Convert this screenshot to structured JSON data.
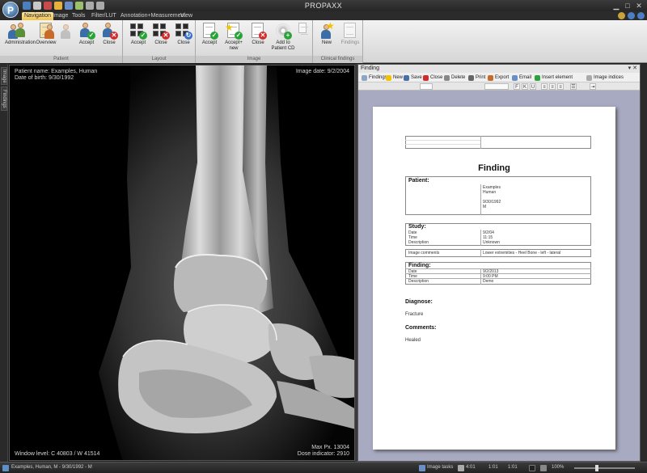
{
  "app": {
    "title": "PROPAXX",
    "logo_letter": "P"
  },
  "tabs": [
    {
      "label": "Navigation",
      "active": true
    },
    {
      "label": "Image"
    },
    {
      "label": "Tools"
    },
    {
      "label": "Filter/LUT"
    },
    {
      "label": "Annotation+Measurement"
    },
    {
      "label": "View"
    }
  ],
  "ribbon": {
    "groups": [
      {
        "label": "Patient",
        "buttons": [
          "Administration",
          "Overview",
          "Accept",
          "Close"
        ]
      },
      {
        "label": "Layout",
        "buttons": [
          "Accept",
          "Close",
          "Close"
        ]
      },
      {
        "label": "Image",
        "buttons": [
          "Accept",
          "Accept+ new",
          "Close",
          "Add to Patient CD"
        ]
      },
      {
        "label": "Clinical findings",
        "buttons": [
          "New",
          "Findings"
        ]
      }
    ]
  },
  "left_tabs": [
    "Image",
    "Findings"
  ],
  "viewer": {
    "patient_name": "Patient name: Examples, Human",
    "dob": "Date of birth: 9/30/1992",
    "image_date": "Image date: 9/2/2004",
    "window_level": "Window level: C 40803 / W 41514",
    "max_px": "Max Px. 13004",
    "dose": "Dose indicator: 2910"
  },
  "finding_panel": {
    "title": "Finding",
    "toolbar": [
      "Findings",
      "New",
      "Save",
      "Close",
      "Delete",
      "Print",
      "Export",
      "Email",
      "Insert element",
      "Image indices"
    ],
    "format_buttons": [
      "F",
      "K",
      "U"
    ],
    "document": {
      "title": "Finding",
      "sections": {
        "patient": "Patient:",
        "study": "Study:",
        "finding": "Finding:",
        "diagnose": "Diagnose:",
        "comments": "Comments:"
      },
      "study_rows": [
        "Date",
        "Time",
        "Description"
      ],
      "study_values": [
        "9/2/04",
        "11:15",
        "Unknown"
      ],
      "image_label": "Image comments",
      "image_value": "Lower extremities - Heel Bone - left - lateral",
      "finding_rows": [
        "Date",
        "Time",
        "Description"
      ],
      "finding_values": [
        "9/2/2013",
        "9:00 PM",
        "Demo"
      ],
      "patient_values": [
        "Examples",
        "Human",
        "9/30/1992",
        "M"
      ],
      "after_diagnose": "Fracture",
      "after_comments": "Healed"
    }
  },
  "statusbar": {
    "left": "Examples, Human, M - 9/30/1992 - M",
    "items": [
      "Image tasks",
      "4:01",
      "1:01",
      "1:01",
      "100%"
    ]
  },
  "colors": {
    "accent": "#f2c04d",
    "panel_bg": "#a8aac2"
  }
}
